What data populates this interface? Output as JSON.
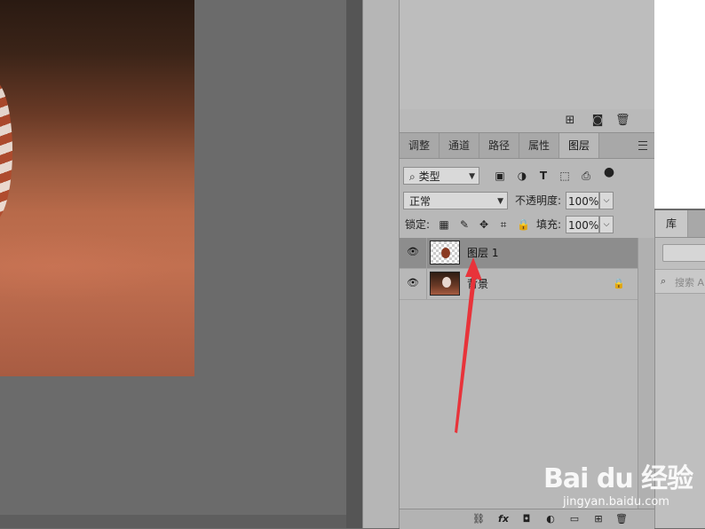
{
  "layers_panel": {
    "tabs": [
      {
        "label": "调整"
      },
      {
        "label": "通道"
      },
      {
        "label": "路径"
      },
      {
        "label": "属性"
      },
      {
        "label": "图层",
        "active": true
      }
    ],
    "filter": {
      "kind_label": "类型"
    },
    "blend_mode": "正常",
    "opacity_label": "不透明度:",
    "opacity_value": "100%",
    "lock_label": "锁定:",
    "fill_label": "填充:",
    "fill_value": "100%",
    "layers": [
      {
        "name": "图层 1",
        "selected": true,
        "locked": false
      },
      {
        "name": "背景",
        "selected": false,
        "locked": true
      }
    ]
  },
  "library_panel": {
    "tab_label": "库",
    "search_placeholder": "搜索 A"
  },
  "watermark": {
    "main": "Bai du 经验",
    "sub": "jingyan.baidu.com"
  },
  "colors": {
    "annotation_arrow": "#e8333a",
    "panel_bg": "#b8b8b8",
    "selected_layer_bg": "#8d8d8d"
  }
}
